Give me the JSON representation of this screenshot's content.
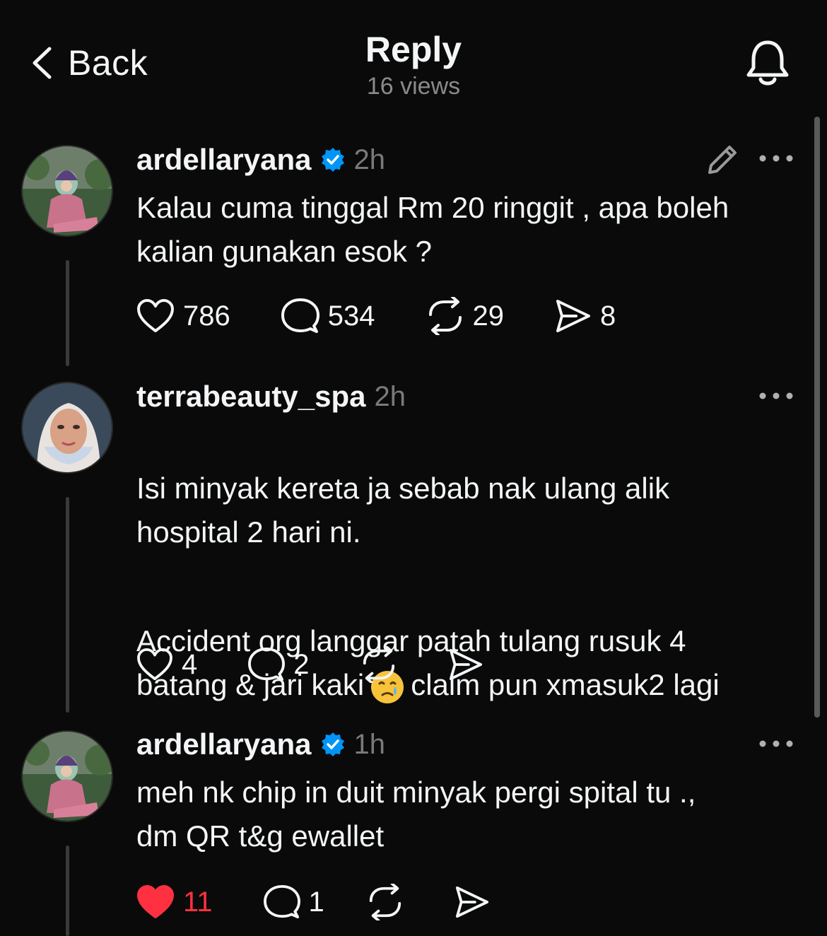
{
  "header": {
    "back_label": "Back",
    "title": "Reply",
    "views": "16 views"
  },
  "posts": [
    {
      "username": "ardellaryana",
      "verified": true,
      "time": "2h",
      "text": "Kalau cuma tinggal Rm 20 ringgit , apa boleh\nkalian  gunakan esok ?",
      "likes": "786",
      "comments": "534",
      "reposts": "29",
      "shares": "8"
    },
    {
      "username": "terrabeauty_spa",
      "verified": false,
      "time": "2h",
      "text": "Isi minyak kereta ja sebab nak ulang alik\nhospital 2 hari ni.",
      "text2_part1": "Accident org langgar patah tulang rusuk 4\nbatang & jari kaki",
      "text2_part2": "claim pun xmasuk2 lagi",
      "emoji": "crying-face",
      "likes": "4",
      "comments": "2"
    },
    {
      "username": "ardellaryana",
      "verified": true,
      "time": "1h",
      "text": "meh nk chip in duit minyak pergi spital tu .,\ndm QR t&g ewallet",
      "likes": "11",
      "liked": true,
      "comments": "1"
    }
  ],
  "colors": {
    "background": "#0a0a0a",
    "text": "#f3f5f7",
    "muted": "#7a7a7a",
    "verified_blue": "#0095f6",
    "like_red": "#ff3040"
  },
  "icons": [
    "chevron-left-icon",
    "bell-icon",
    "verified-badge-icon",
    "edit-pencil-icon",
    "more-icon",
    "heart-icon",
    "comment-icon",
    "repost-icon",
    "share-icon"
  ]
}
